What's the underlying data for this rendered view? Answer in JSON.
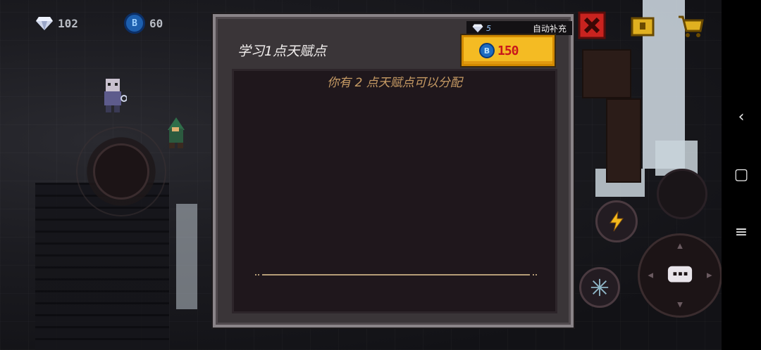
{
  "hud": {
    "gems": "102",
    "coins": "60",
    "coin_symbol": "B"
  },
  "modal": {
    "title": "学习1点天赋点",
    "gem_cost": "5",
    "auto_refill": "自动补充",
    "coin_symbol": "B",
    "coin_cost": "150",
    "points_message": "你有 2 点天赋点可以分配"
  },
  "colors": {
    "modal_frame": "#8a8488",
    "inner_panel": "#1f171c",
    "message_text": "#c79b64",
    "coin_button": "#f4bb23",
    "coin_cost_text": "#c9161b"
  },
  "icons": [
    "gem-icon",
    "coin-icon",
    "close-icon",
    "treasure-icon",
    "shop-cart-icon",
    "exit-icon",
    "lightning-skill-icon",
    "snowflake-skill-icon",
    "chat-icon",
    "back-icon",
    "home-icon",
    "menu-icon"
  ]
}
